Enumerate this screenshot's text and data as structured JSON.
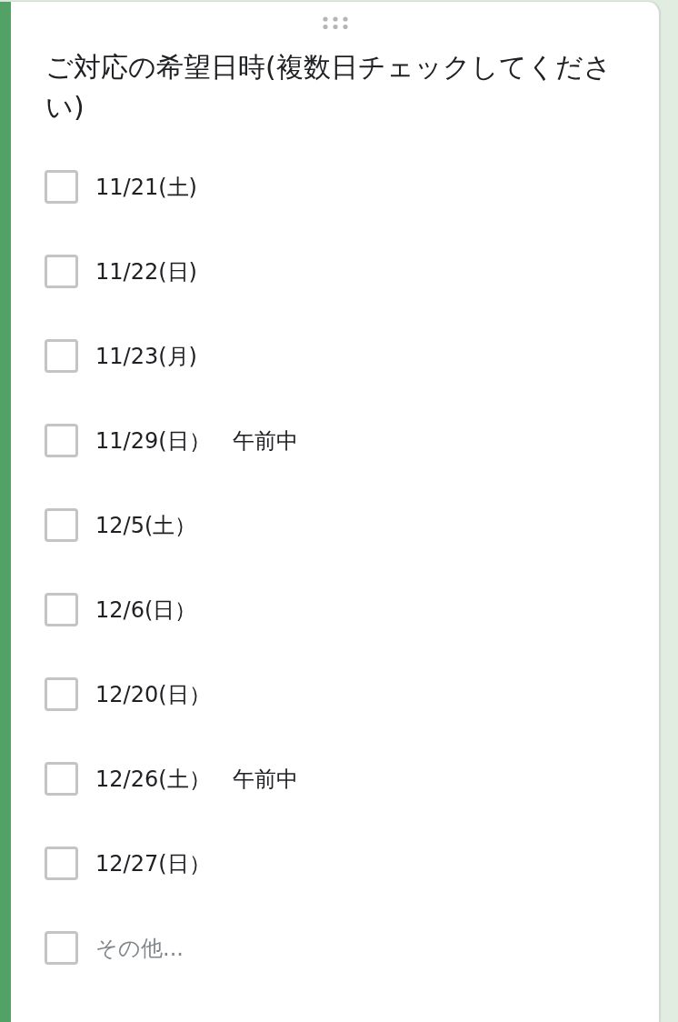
{
  "question": {
    "title": "ご対応の希望日時(複数日チェックしてください)"
  },
  "options": [
    {
      "label": "11/21(土)",
      "checked": false,
      "kind": "choice"
    },
    {
      "label": "11/22(日)",
      "checked": false,
      "kind": "choice"
    },
    {
      "label": "11/23(月)",
      "checked": false,
      "kind": "choice"
    },
    {
      "label": "11/29(日）　午前中",
      "checked": false,
      "kind": "choice"
    },
    {
      "label": "12/5(土）",
      "checked": false,
      "kind": "choice"
    },
    {
      "label": "12/6(日）",
      "checked": false,
      "kind": "choice"
    },
    {
      "label": "12/20(日）",
      "checked": false,
      "kind": "choice"
    },
    {
      "label": "12/26(土）　午前中",
      "checked": false,
      "kind": "choice"
    },
    {
      "label": "12/27(日）",
      "checked": false,
      "kind": "choice"
    },
    {
      "label": "その他...",
      "checked": false,
      "kind": "other"
    }
  ]
}
